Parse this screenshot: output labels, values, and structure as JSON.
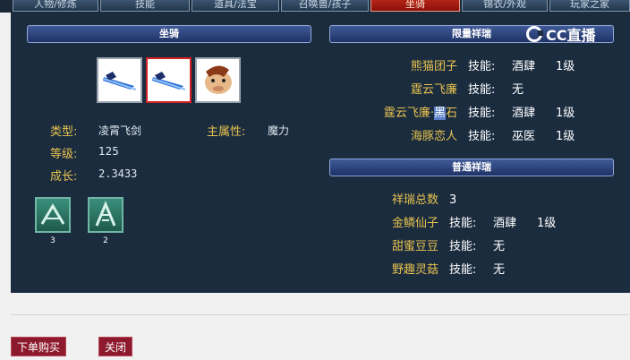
{
  "tabs": [
    {
      "label": "人物/修炼"
    },
    {
      "label": "技能"
    },
    {
      "label": "道具/法宝"
    },
    {
      "label": "召唤兽/孩子"
    },
    {
      "label": "坐骑"
    },
    {
      "label": "锦衣/外观"
    },
    {
      "label": "玩家之家"
    }
  ],
  "mount": {
    "header": "坐骑",
    "info": {
      "type_label": "类型:",
      "type_value": "凌霄飞剑",
      "attr_label": "主属性:",
      "attr_value": "魔力",
      "level_label": "等级:",
      "level_value": "125",
      "growth_label": "成长:",
      "growth_value": "2.3433"
    },
    "skills": [
      {
        "icon": "mount-skill-icon",
        "count": "3"
      },
      {
        "icon": "mount-skill-icon",
        "count": "2"
      }
    ]
  },
  "limited": {
    "header": "限量祥瑞",
    "items": [
      {
        "name": "熊猫团子",
        "skill_label": "技能:",
        "skill": "酒肆",
        "level": "1级"
      },
      {
        "name": "霆云飞廉",
        "skill_label": "技能:",
        "skill": "无",
        "level": ""
      },
      {
        "name_pre": "霆云飞廉·",
        "name_hl": "黑",
        "name_post": "石",
        "skill_label": "技能:",
        "skill": "酒肆",
        "level": "1级"
      },
      {
        "name": "海豚恋人",
        "skill_label": "技能:",
        "skill": "巫医",
        "level": "1级"
      }
    ]
  },
  "normal": {
    "header": "普通祥瑞",
    "total_label": "祥瑞总数",
    "total_value": "3",
    "items": [
      {
        "name": "金鳞仙子",
        "skill_label": "技能:",
        "skill": "酒肆",
        "level": "1级"
      },
      {
        "name": "甜蜜豆豆",
        "skill_label": "技能:",
        "skill": "无",
        "level": ""
      },
      {
        "name": "野趣灵菇",
        "skill_label": "技能:",
        "skill": "无",
        "level": ""
      }
    ]
  },
  "watermark": {
    "text": "CC直播"
  },
  "buttons": {
    "buy": "下单购买",
    "close": "关闭"
  },
  "colors": {
    "panel": "#1b2c3f",
    "gold": "#e7c24e",
    "header_bar": "#2a4180",
    "button": "#8c1a2c"
  }
}
